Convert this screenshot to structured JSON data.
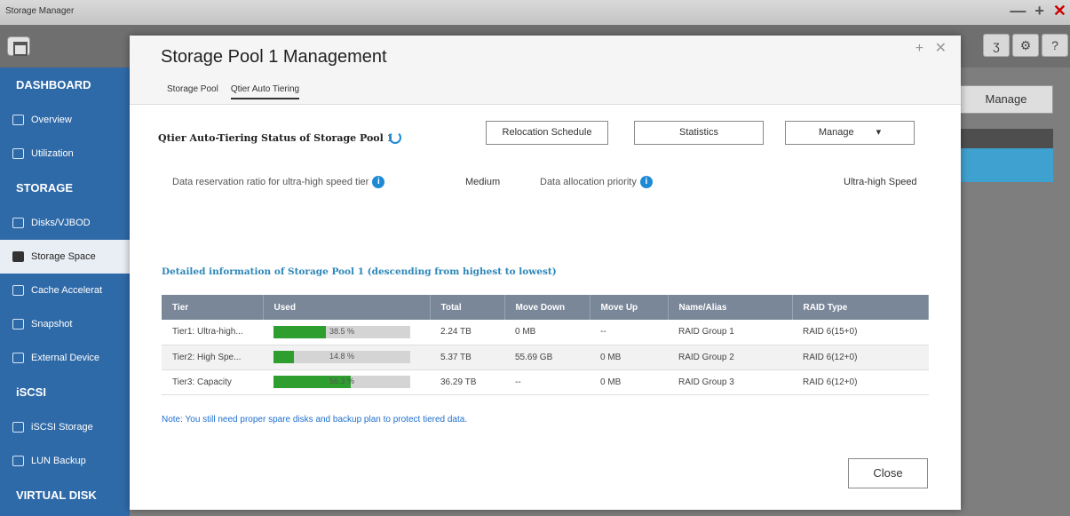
{
  "window": {
    "title": "Storage Manager",
    "controls": {
      "minimize": "—",
      "add": "+",
      "close": "✕"
    }
  },
  "toolbar": {
    "right_icons": [
      "ʒ",
      "⚙",
      "?"
    ]
  },
  "background": {
    "manage_label": "Manage"
  },
  "sidebar": {
    "items": [
      {
        "type": "head",
        "label": "DASHBOARD"
      },
      {
        "type": "item",
        "label": "Overview",
        "icon": "overview-icon"
      },
      {
        "type": "item",
        "label": "Utilization",
        "icon": "utilization-icon"
      },
      {
        "type": "head",
        "label": "STORAGE"
      },
      {
        "type": "item",
        "label": "Disks/VJBOD",
        "icon": "disks-icon"
      },
      {
        "type": "item",
        "label": "Storage Space",
        "icon": "storage-space-icon",
        "active": true
      },
      {
        "type": "item",
        "label": "Cache Accelerat",
        "icon": "cache-icon"
      },
      {
        "type": "item",
        "label": "Snapshot",
        "icon": "snapshot-icon"
      },
      {
        "type": "item",
        "label": "External Device",
        "icon": "external-device-icon"
      },
      {
        "type": "head",
        "label": "iSCSI"
      },
      {
        "type": "item",
        "label": "iSCSI Storage",
        "icon": "iscsi-storage-icon"
      },
      {
        "type": "item",
        "label": "LUN Backup",
        "icon": "lun-backup-icon"
      },
      {
        "type": "head",
        "label": "VIRTUAL DISK"
      }
    ]
  },
  "dialog": {
    "title": "Storage Pool 1 Management",
    "controls": "+ ✕",
    "tabs": [
      "Storage Pool",
      "Qtier Auto Tiering"
    ],
    "active_tab": 1,
    "status_title": "Qtier Auto-Tiering Status of Storage Pool 1",
    "buttons": {
      "relocation": "Relocation Schedule",
      "statistics": "Statistics",
      "manage": "Manage",
      "manage_caret": "▾"
    },
    "info": {
      "reservation_label": "Data reservation ratio for ultra-high speed tier",
      "reservation_value": "Medium",
      "allocation_label": "Data allocation priority",
      "allocation_value": "Ultra-high Speed",
      "info_glyph": "i"
    },
    "detail_title": "Detailed information of Storage Pool 1 (descending from highest to lowest)",
    "table": {
      "headers": [
        "Tier",
        "Used",
        "Total",
        "Move Down",
        "Move Up",
        "Name/Alias",
        "RAID Type"
      ],
      "rows": [
        {
          "tier": "Tier1: Ultra-high...",
          "used_pct": 38.5,
          "used_label": "38.5 %",
          "total": "2.24 TB",
          "move_down": "0 MB",
          "move_up": "--",
          "name": "RAID Group 1",
          "raid": "RAID 6(15+0)"
        },
        {
          "tier": "Tier2: High Spe...",
          "used_pct": 14.8,
          "used_label": "14.8 %",
          "total": "5.37 TB",
          "move_down": "55.69 GB",
          "move_up": "0 MB",
          "name": "RAID Group 2",
          "raid": "RAID 6(12+0)"
        },
        {
          "tier": "Tier3: Capacity",
          "used_pct": 56.3,
          "used_label": "56.3 %",
          "total": "36.29 TB",
          "move_down": "--",
          "move_up": "0 MB",
          "name": "RAID Group 3",
          "raid": "RAID 6(12+0)"
        }
      ]
    },
    "note": "Note: You still need proper spare disks and backup plan to protect tiered data.",
    "close_label": "Close"
  }
}
